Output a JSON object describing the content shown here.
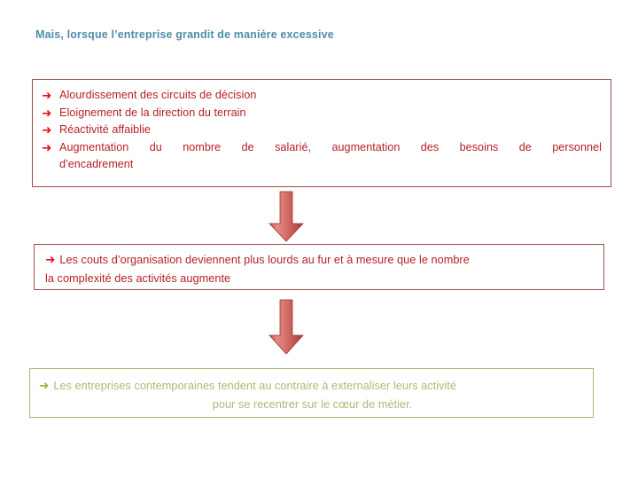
{
  "slide": {
    "background_color": "#FFFFFF",
    "heading": {
      "text": "Mais, lorsque l’entreprise grandit de manière excessive",
      "color": "#4E8EA6"
    },
    "box1": {
      "border_color": "#A04B4B",
      "text_color": "#B52025",
      "bullet_color": "#E60D20",
      "bullet_glyph": "➜",
      "items": [
        {
          "text": "Alourdissement des circuits de décision"
        },
        {
          "text": "Eloignement de la direction du terrain"
        },
        {
          "text": "Réactivité affaiblie"
        },
        {
          "text": "Augmentation du nombre de salarié, augmentation des besoins de personnel",
          "continuation": "d’encadrement"
        }
      ]
    },
    "arrow1": {
      "name": "down-arrow",
      "color_light": "#E8807A",
      "color_dark": "#B03A35"
    },
    "box2": {
      "border_color": "#A04B4B",
      "text_color": "#B52025",
      "bullet_color": "#E60D20",
      "bullet_glyph": "➜",
      "line1": "Les couts d’organisation deviennent plus lourds au fur et à mesure que le nombre",
      "line2": "la complexité des activités augmente"
    },
    "arrow2": {
      "name": "down-arrow",
      "color_light": "#E8807A",
      "color_dark": "#B03A35"
    },
    "box3": {
      "border_color": "#A9BC72",
      "text_color": "#A8BC76",
      "bullet_color": "#8FB93F",
      "bullet_glyph": "➜",
      "line1": "Les entreprises contemporaines tendent au contraire à externaliser leurs activité",
      "line2": "pour se recentrer sur le cœur de métier."
    }
  }
}
